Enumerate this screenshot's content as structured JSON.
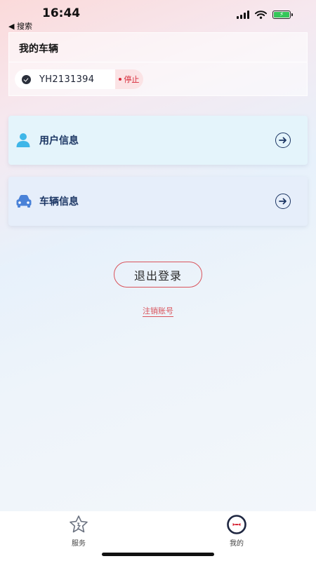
{
  "status_bar": {
    "time": "16:44",
    "back_label": "◀ 搜索"
  },
  "vehicle_section": {
    "title": "我的车辆",
    "plate": "YH2131394",
    "status": "停止",
    "status_color": "#d72b3a"
  },
  "menu": {
    "user_info": {
      "label": "用户信息",
      "icon": "user-icon"
    },
    "vehicle_info": {
      "label": "车辆信息",
      "icon": "car-icon"
    }
  },
  "actions": {
    "logout_label": "退出登录",
    "cancel_account_label": "注销账号"
  },
  "tab_bar": {
    "tabs": [
      {
        "label": "服务",
        "icon": "service-star-icon",
        "active": false
      },
      {
        "label": "我的",
        "icon": "profile-icon",
        "active": true
      }
    ]
  },
  "colors": {
    "accent_red": "#d9535b",
    "navy": "#1b3563",
    "user_icon": "#3fb6e8",
    "car_icon": "#4a82d8"
  }
}
